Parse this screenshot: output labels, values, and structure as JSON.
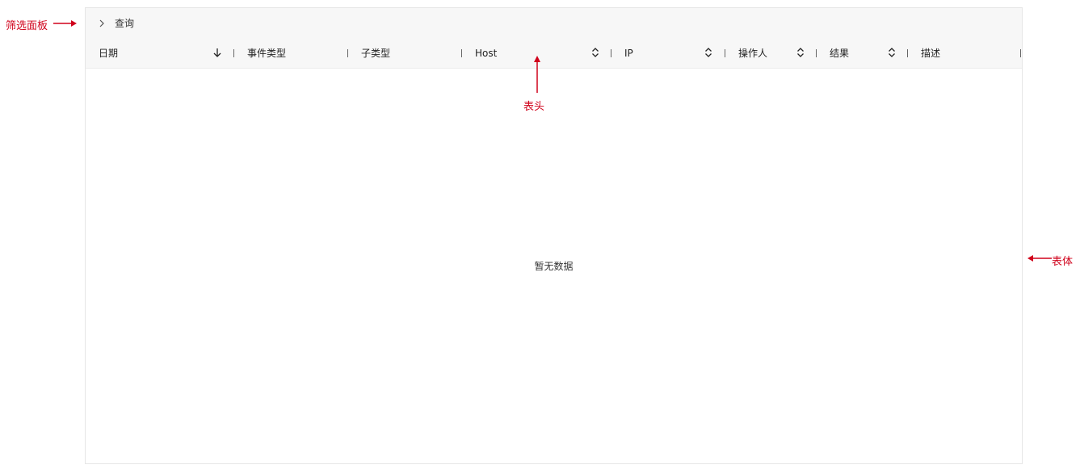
{
  "filter_panel": {
    "toggle_icon": "chevron-right-icon",
    "label": "查询"
  },
  "table": {
    "columns": [
      {
        "label": "日期",
        "sort": "desc"
      },
      {
        "label": "事件类型",
        "sort": "none"
      },
      {
        "label": "子类型",
        "sort": "none"
      },
      {
        "label": "Host",
        "sort": "both"
      },
      {
        "label": "IP",
        "sort": "both"
      },
      {
        "label": "操作人",
        "sort": "both"
      },
      {
        "label": "结果",
        "sort": "both"
      },
      {
        "label": "描述",
        "sort": "none"
      }
    ],
    "empty_text": "暂无数据"
  },
  "annotations": {
    "filter_panel": "筛选面板",
    "header": "表头",
    "body": "表体",
    "color": "#d0021b"
  }
}
